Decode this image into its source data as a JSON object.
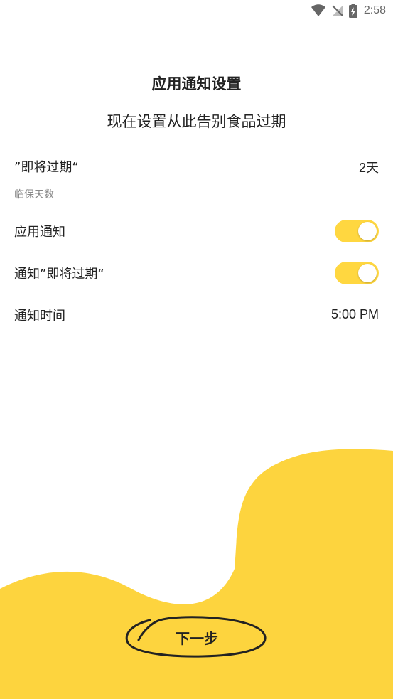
{
  "status_bar": {
    "time": "2:58",
    "icons": [
      "wifi-icon",
      "no-signal-icon",
      "battery-charging-icon"
    ]
  },
  "header": {
    "title": "应用通知设置",
    "subtitle": "现在设置从此告别食品过期"
  },
  "settings": {
    "expiry_days": {
      "label": "”即将过期“",
      "sublabel": "临保天数",
      "value": "2天"
    },
    "app_notification": {
      "label": "应用通知",
      "enabled": true
    },
    "notify_expiring": {
      "label": "通知”即将过期“",
      "enabled": true
    },
    "notify_time": {
      "label": "通知时间",
      "value": "5:00 PM"
    }
  },
  "footer": {
    "next_label": "下一步"
  },
  "colors": {
    "accent": "#ffd740",
    "wave": "#fdd43e",
    "text": "#222222",
    "subtext": "#888888",
    "divider": "#ececec"
  }
}
